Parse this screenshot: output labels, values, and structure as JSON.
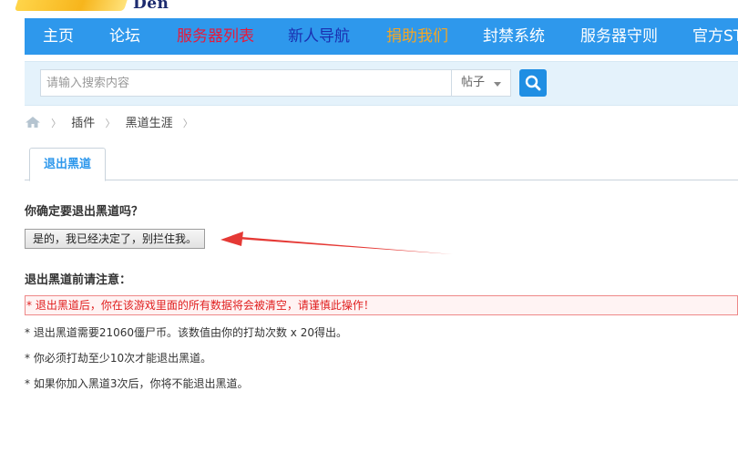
{
  "logo": {
    "text": "Den"
  },
  "nav": {
    "items": [
      {
        "label": "主页",
        "color": "#ffffff"
      },
      {
        "label": "论坛",
        "color": "#ffffff"
      },
      {
        "label": "服务器列表",
        "color": "#e8193a"
      },
      {
        "label": "新人导航",
        "color": "#1b2fb0"
      },
      {
        "label": "捐助我们",
        "color": "#f5a623"
      },
      {
        "label": "封禁系统",
        "color": "#ffffff"
      },
      {
        "label": "服务器守则",
        "color": "#ffffff"
      },
      {
        "label": "官方ST",
        "color": "#ffffff"
      }
    ]
  },
  "search": {
    "placeholder": "请输入搜索内容",
    "type_value": "帖子"
  },
  "breadcrumb": {
    "items": [
      "插件",
      "黑道生涯"
    ]
  },
  "tabs": {
    "active_label": "退出黑道"
  },
  "content": {
    "question": "你确定要退出黑道吗？",
    "confirm_button": "是的，我已经决定了，别拦住我。",
    "notice_title": "退出黑道前请注意：",
    "warning": "* 退出黑道后，你在该游戏里面的所有数据将会被清空，请谨慎此操作！",
    "notes": [
      "* 退出黑道需要21060僵尸币。该数值由你的打劫次数 x 20得出。",
      "* 你必须打劫至少10次才能退出黑道。",
      "* 如果你加入黑道3次后，你将不能退出黑道。"
    ]
  },
  "colors": {
    "nav_bg": "#2e98ec",
    "search_bg": "#e4f2fb",
    "warn_text": "#e02020",
    "arrow": "#e53935"
  }
}
